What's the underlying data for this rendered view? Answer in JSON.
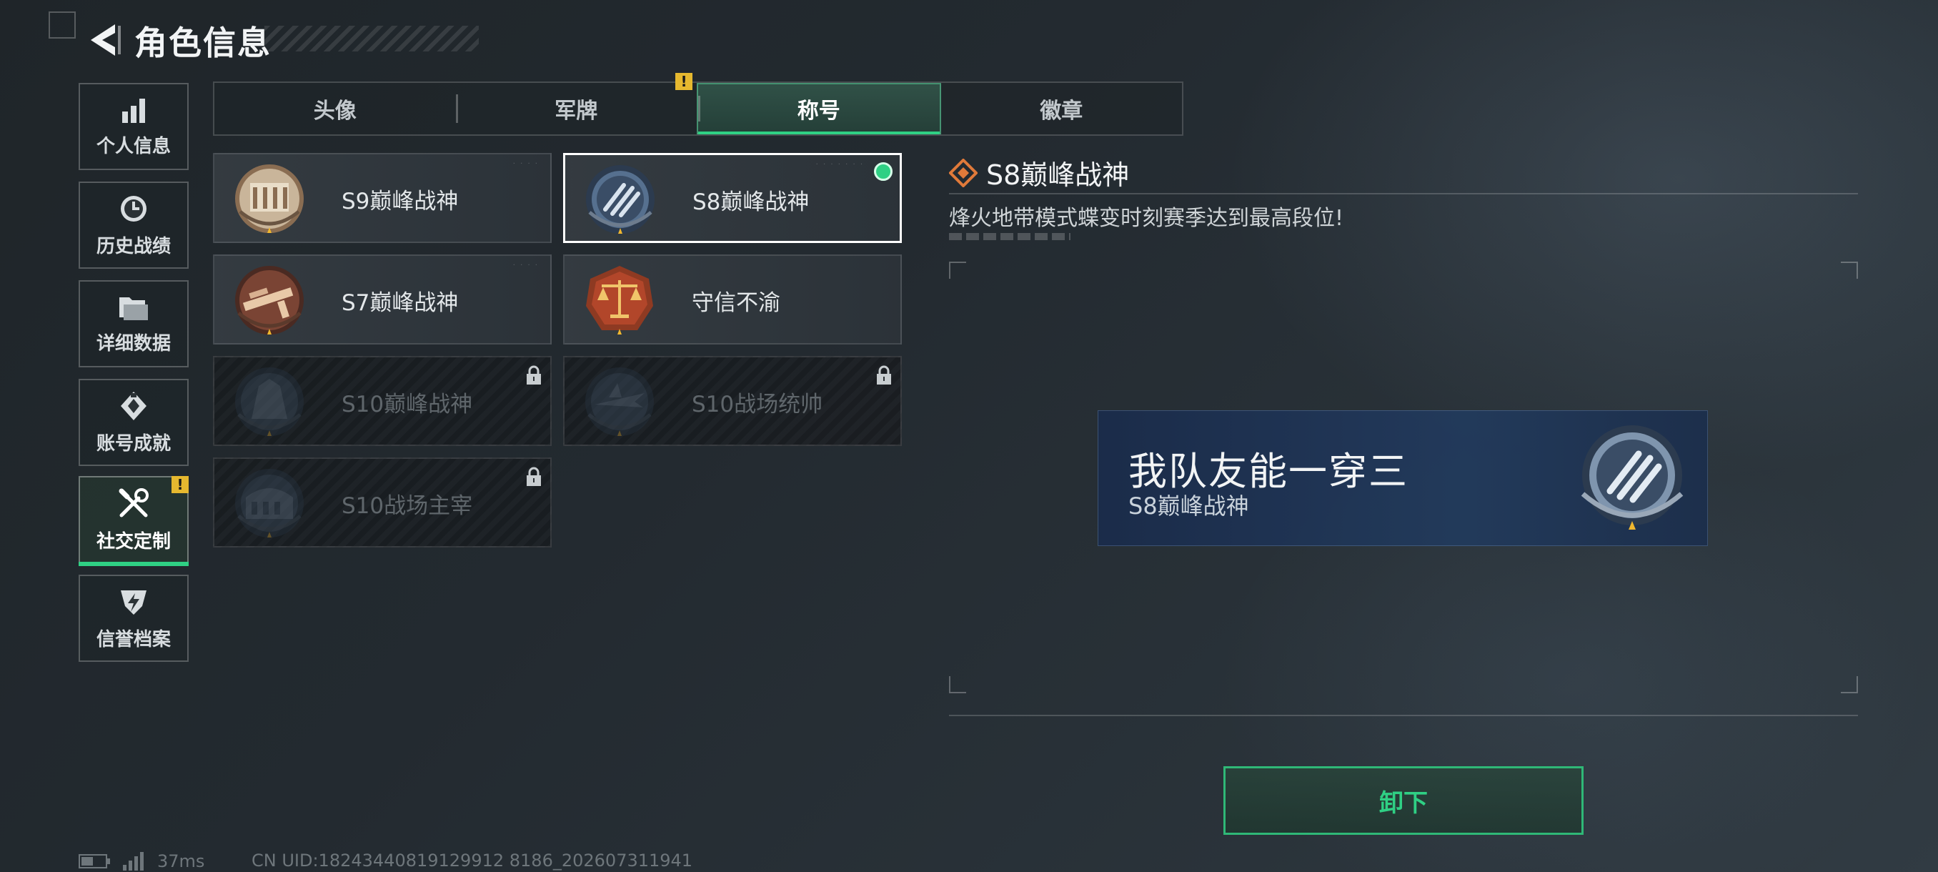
{
  "header": {
    "title": "角色信息"
  },
  "nav": {
    "items": [
      {
        "label": "个人信息",
        "icon": "bar-chart-icon"
      },
      {
        "label": "历史战绩",
        "icon": "clock-icon"
      },
      {
        "label": "详细数据",
        "icon": "folder-icon"
      },
      {
        "label": "账号成就",
        "icon": "achievement-icon"
      },
      {
        "label": "社交定制",
        "icon": "tools-icon",
        "active": true,
        "badge": "!"
      },
      {
        "label": "信誉档案",
        "icon": "credit-shield-icon"
      }
    ]
  },
  "tabs": {
    "items": [
      {
        "label": "头像"
      },
      {
        "label": "军牌",
        "badge": "!"
      },
      {
        "label": "称号",
        "active": true
      },
      {
        "label": "徽章"
      }
    ]
  },
  "titles": [
    {
      "label": "S9巅峰战神",
      "locked": false
    },
    {
      "label": "S8巅峰战神",
      "locked": false,
      "selected": true,
      "equipped": true
    },
    {
      "label": "S7巅峰战神",
      "locked": false
    },
    {
      "label": "守信不渝",
      "locked": false
    },
    {
      "label": "S10巅峰战神",
      "locked": true
    },
    {
      "label": "S10战场统帅",
      "locked": true
    },
    {
      "label": "S10战场主宰",
      "locked": true
    }
  ],
  "detail": {
    "title": "S8巅峰战神",
    "description": "烽火地带模式蝶变时刻赛季达到最高段位!"
  },
  "banner": {
    "player_name": "我队友能一穿三",
    "title": "S8巅峰战神"
  },
  "actions": {
    "unequip_label": "卸下"
  },
  "status": {
    "ping": "37ms",
    "uid": "CN UID:18243440819129912 8186_202607311941"
  },
  "colors": {
    "accent_green": "#2fd084",
    "warning_yellow": "#e6b82f",
    "diamond_orange": "#e07a3a"
  }
}
